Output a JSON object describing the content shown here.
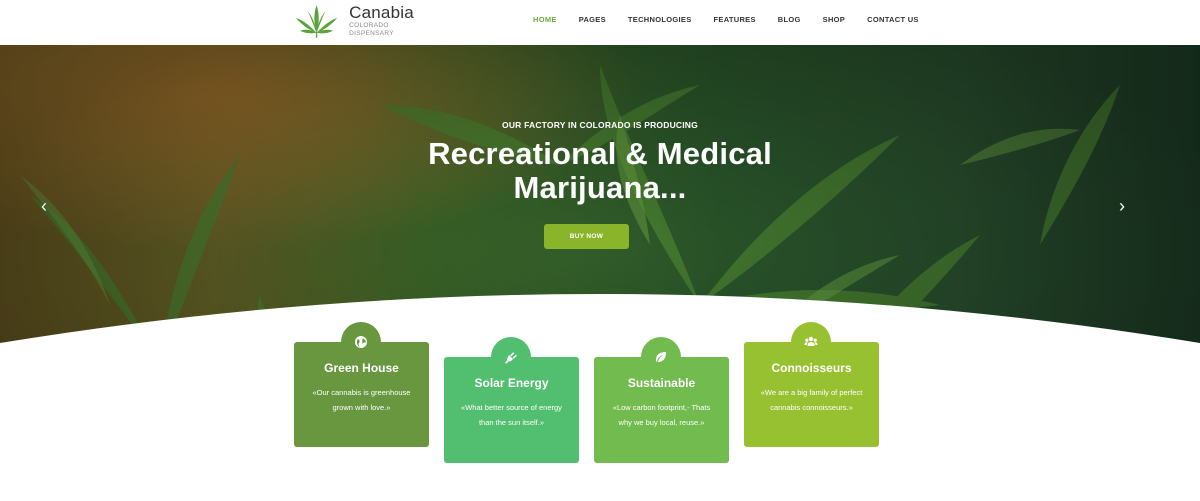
{
  "brand": {
    "name": "Canabia",
    "tagline": "COLORADO DISPENSARY"
  },
  "nav": {
    "items": [
      {
        "label": "HOME",
        "active": true
      },
      {
        "label": "PAGES"
      },
      {
        "label": "TECHNOLOGIES"
      },
      {
        "label": "FEATURES"
      },
      {
        "label": "BLOG"
      },
      {
        "label": "SHOP"
      },
      {
        "label": "CONTACT US"
      }
    ]
  },
  "hero": {
    "eyebrow": "OUR FACTORY IN COLORADO IS PRODUCING",
    "title_line1": "Recreational & Medical",
    "title_line2": "Marijuana...",
    "button": "BUY NOW",
    "arrow_left": "‹",
    "arrow_right": "›",
    "slides": 3,
    "active_slide": 1
  },
  "cards": [
    {
      "title": "Green House",
      "text": "«Our cannabis is greenhouse grown with love.»",
      "icon": "globe-icon",
      "color": "#69973f"
    },
    {
      "title": "Solar Energy",
      "text": "«What better source of energy than the sun itself.»",
      "icon": "plug-icon",
      "color": "#52be6f"
    },
    {
      "title": "Sustainable",
      "text": "«Low carbon footprint,- Thats why we buy local, reuse.»",
      "icon": "leaf-icon",
      "color": "#72bb4e"
    },
    {
      "title": "Connoisseurs",
      "text": "«We are a big family of perfect cannabis connoisseurs.»",
      "icon": "users-icon",
      "color": "#98c131"
    }
  ],
  "colors": {
    "accent": "#6aad3b",
    "button": "#8ab52b"
  }
}
